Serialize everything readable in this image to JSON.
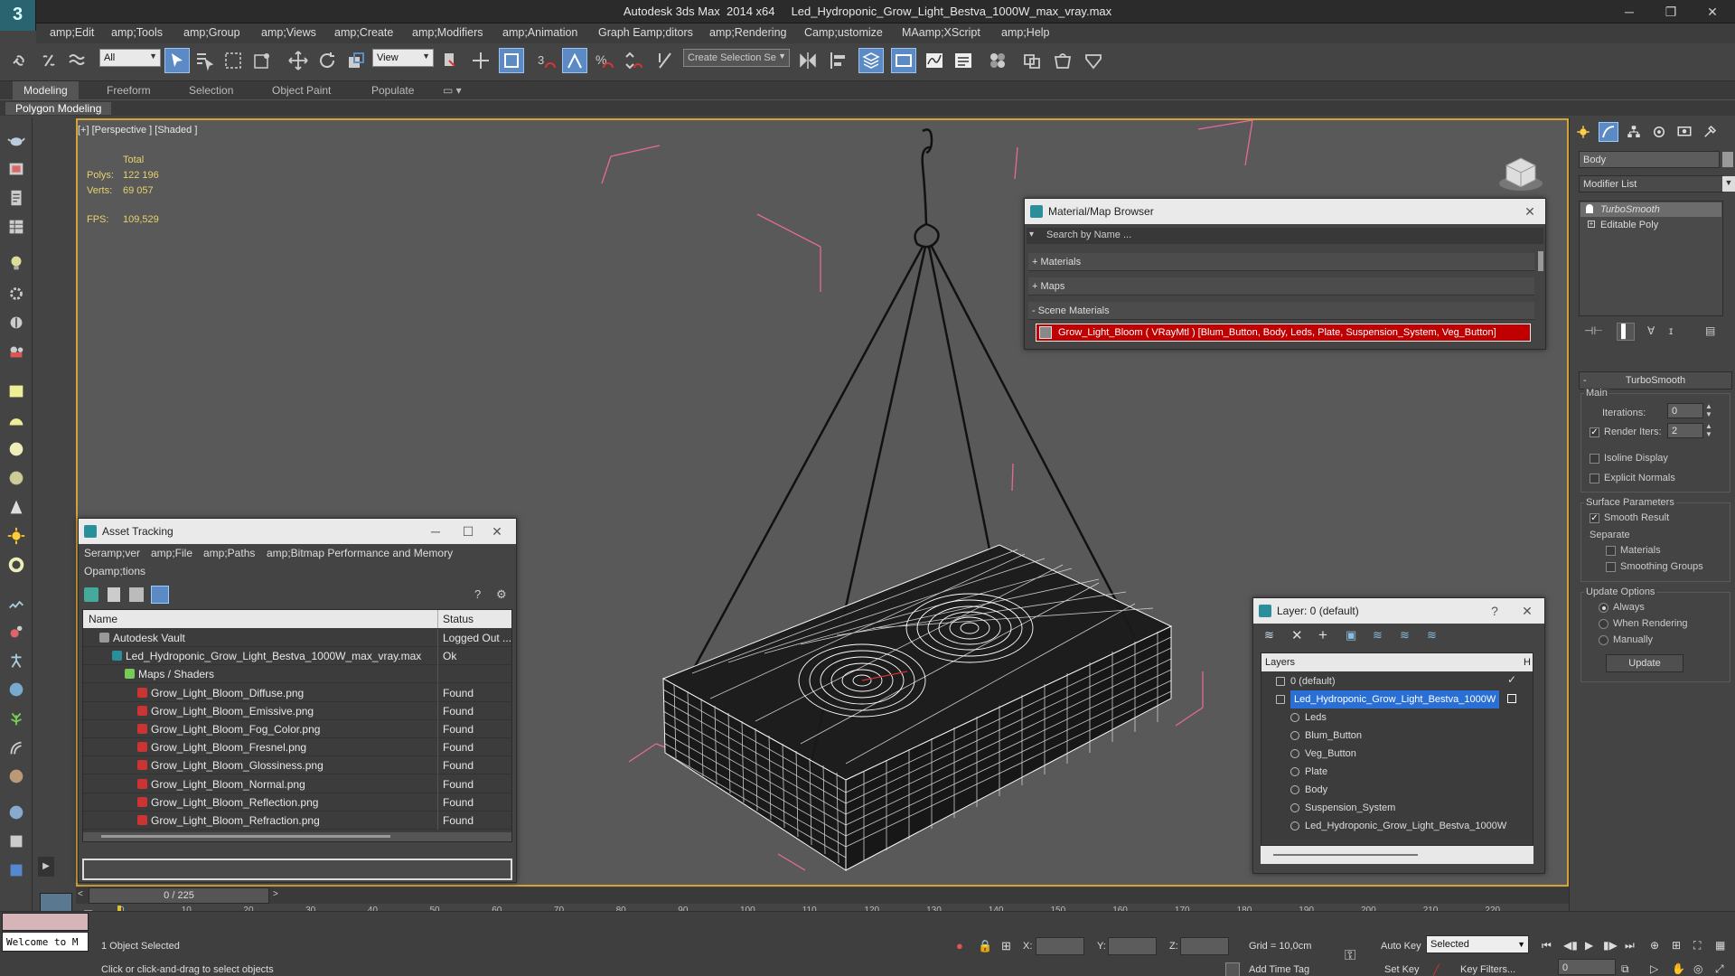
{
  "titlebar": {
    "title": "Autodesk 3ds Max  2014 x64     Led_Hydroponic_Grow_Light_Bestva_1000W_max_vray.max",
    "min": "─",
    "restore": "❐",
    "close": "✕"
  },
  "logo": "3",
  "menu": [
    "amp;Edit",
    "amp;Tools",
    "amp;Group",
    "amp;Views",
    "amp;Create",
    "amp;Modifiers",
    "amp;Animation",
    "Graph Eamp;ditors",
    "amp;Rendering",
    "Camp;ustomize",
    "MAamp;XScript",
    "amp;Help"
  ],
  "toolbar": {
    "selection_filter": "All",
    "ref_coord": "View",
    "named_selection": "Create Selection Se"
  },
  "ribbon": {
    "tabs": [
      "Modeling",
      "Freeform",
      "Selection",
      "Object Paint",
      "Populate"
    ],
    "panel": "Polygon Modeling"
  },
  "viewport": {
    "label": "[+] [Perspective ] [Shaded ]",
    "total": "Total",
    "polys_label": "Polys:",
    "polys": "122 196",
    "verts_label": "Verts:",
    "verts": "69 057",
    "fps_label": "FPS:",
    "fps": "109,529"
  },
  "material_browser": {
    "title": "Material/Map Browser",
    "search_placeholder": "Search by Name ...",
    "sections": [
      "+ Materials",
      "+ Maps",
      "- Scene Materials"
    ],
    "material": "Grow_Light_Bloom ( VRayMtl ) [Blum_Button, Body, Leds, Plate, Suspension_System, Veg_Button]"
  },
  "asset_tracking": {
    "title": "Asset Tracking",
    "menu": [
      "Seramp;ver",
      "amp;File",
      "amp;Paths",
      "amp;Bitmap Performance and Memory",
      "Opamp;tions"
    ],
    "col_name": "Name",
    "col_status": "Status",
    "rows": [
      {
        "name": "Autodesk Vault",
        "status": "Logged Out ...",
        "indent": 1
      },
      {
        "name": "Led_Hydroponic_Grow_Light_Bestva_1000W_max_vray.max",
        "status": "Ok",
        "indent": 2
      },
      {
        "name": "Maps / Shaders",
        "status": "",
        "indent": 3
      },
      {
        "name": "Grow_Light_Bloom_Diffuse.png",
        "status": "Found",
        "indent": 4
      },
      {
        "name": "Grow_Light_Bloom_Emissive.png",
        "status": "Found",
        "indent": 4
      },
      {
        "name": "Grow_Light_Bloom_Fog_Color.png",
        "status": "Found",
        "indent": 4
      },
      {
        "name": "Grow_Light_Bloom_Fresnel.png",
        "status": "Found",
        "indent": 4
      },
      {
        "name": "Grow_Light_Bloom_Glossiness.png",
        "status": "Found",
        "indent": 4
      },
      {
        "name": "Grow_Light_Bloom_Normal.png",
        "status": "Found",
        "indent": 4
      },
      {
        "name": "Grow_Light_Bloom_Reflection.png",
        "status": "Found",
        "indent": 4
      },
      {
        "name": "Grow_Light_Bloom_Refraction.png",
        "status": "Found",
        "indent": 4
      }
    ]
  },
  "layer_window": {
    "title": "Layer: 0 (default)",
    "help": "?",
    "col_layers": "Layers",
    "col_hide": "H",
    "rows": [
      {
        "name": "0 (default)",
        "level": 0,
        "selected": false
      },
      {
        "name": "Led_Hydroponic_Grow_Light_Bestva_1000W",
        "level": 0,
        "selected": true
      },
      {
        "name": "Leds",
        "level": 1,
        "selected": false
      },
      {
        "name": "Blum_Button",
        "level": 1,
        "selected": false
      },
      {
        "name": "Veg_Button",
        "level": 1,
        "selected": false
      },
      {
        "name": "Plate",
        "level": 1,
        "selected": false
      },
      {
        "name": "Body",
        "level": 1,
        "selected": false
      },
      {
        "name": "Suspension_System",
        "level": 1,
        "selected": false
      },
      {
        "name": "Led_Hydroponic_Grow_Light_Bestva_1000W",
        "level": 1,
        "selected": false
      }
    ]
  },
  "command_panel": {
    "object_name": "Body",
    "modifier_list": "Modifier List",
    "stack": [
      "TurboSmooth",
      "Editable Poly"
    ],
    "rollout_title": "TurboSmooth",
    "main": "Main",
    "iterations_label": "Iterations:",
    "iterations": "0",
    "render_iters_label": "Render Iters:",
    "render_iters": "2",
    "isoline": "Isoline Display",
    "explicit": "Explicit Normals",
    "surface_params": "Surface Parameters",
    "smooth_result": "Smooth Result",
    "separate": "Separate",
    "materials": "Materials",
    "smoothing_groups": "Smoothing Groups",
    "update_options": "Update Options",
    "always": "Always",
    "when_rendering": "When Rendering",
    "manually": "Manually",
    "update_btn": "Update"
  },
  "timeline": {
    "frame": "0 / 225",
    "ticks": [
      "0",
      "10",
      "20",
      "30",
      "40",
      "50",
      "60",
      "70",
      "80",
      "90",
      "100",
      "110",
      "120",
      "130",
      "140",
      "150",
      "160",
      "170",
      "180",
      "190",
      "200",
      "210",
      "220"
    ]
  },
  "status": {
    "welcome": "Welcome to M",
    "selected": "1 Object Selected",
    "hint": "Click or click-and-drag to select objects",
    "x_label": "X:",
    "y_label": "Y:",
    "z_label": "Z:",
    "grid": "Grid = 10,0cm",
    "add_time_tag": "Add Time Tag",
    "auto_key": "Auto Key",
    "set_key": "Set Key",
    "key_mode": "Selected",
    "key_filters": "Key Filters...",
    "frame_field": "0"
  }
}
